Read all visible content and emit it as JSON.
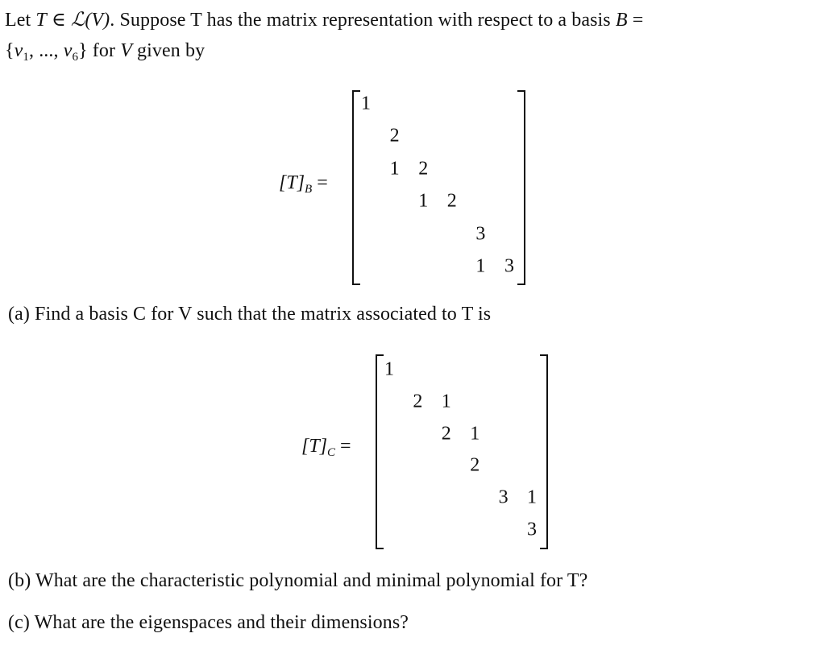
{
  "intro": {
    "line1": {
      "let": "Let ",
      "T": "T",
      "in": " ∈ ",
      "L": "ℒ",
      "V_paren": "(V)",
      "rest": ". Suppose T has the matrix representation with respect to a basis ",
      "B": "B",
      "eq": " ="
    },
    "line2": {
      "open": "{",
      "v": "v",
      "sub1": "1",
      "dots": ", ..., ",
      "v6": "v",
      "sub6": "6",
      "close": "}",
      "rest1": " for ",
      "V": "V",
      "rest2": " given by"
    }
  },
  "matrix_B": {
    "lhs_T": "[T]",
    "lhs_sub": "B",
    "lhs_eq": " =",
    "entries": [
      {
        "row": 1,
        "col": 1,
        "value": "1"
      },
      {
        "row": 2,
        "col": 2,
        "value": "2"
      },
      {
        "row": 3,
        "col": 2,
        "value": "1"
      },
      {
        "row": 3,
        "col": 3,
        "value": "2"
      },
      {
        "row": 4,
        "col": 3,
        "value": "1"
      },
      {
        "row": 4,
        "col": 4,
        "value": "2"
      },
      {
        "row": 5,
        "col": 5,
        "value": "3"
      },
      {
        "row": 6,
        "col": 5,
        "value": "1"
      },
      {
        "row": 6,
        "col": 6,
        "value": "3"
      }
    ]
  },
  "part_a": "(a)  Find a basis C for V such that the matrix associated to T is",
  "matrix_C": {
    "lhs_T": "[T]",
    "lhs_sub": "C",
    "lhs_eq": " =",
    "entries": [
      {
        "row": 1,
        "col": 1,
        "value": "1"
      },
      {
        "row": 2,
        "col": 2,
        "value": "2"
      },
      {
        "row": 2,
        "col": 3,
        "value": "1"
      },
      {
        "row": 3,
        "col": 3,
        "value": "2"
      },
      {
        "row": 3,
        "col": 4,
        "value": "1"
      },
      {
        "row": 4,
        "col": 4,
        "value": "2"
      },
      {
        "row": 5,
        "col": 5,
        "value": "3"
      },
      {
        "row": 5,
        "col": 6,
        "value": "1"
      },
      {
        "row": 6,
        "col": 6,
        "value": "3"
      }
    ]
  },
  "part_b": "(b)  What are the characteristic polynomial and minimal polynomial for T?",
  "part_c": "(c)  What are the eigenspaces and their dimensions?"
}
